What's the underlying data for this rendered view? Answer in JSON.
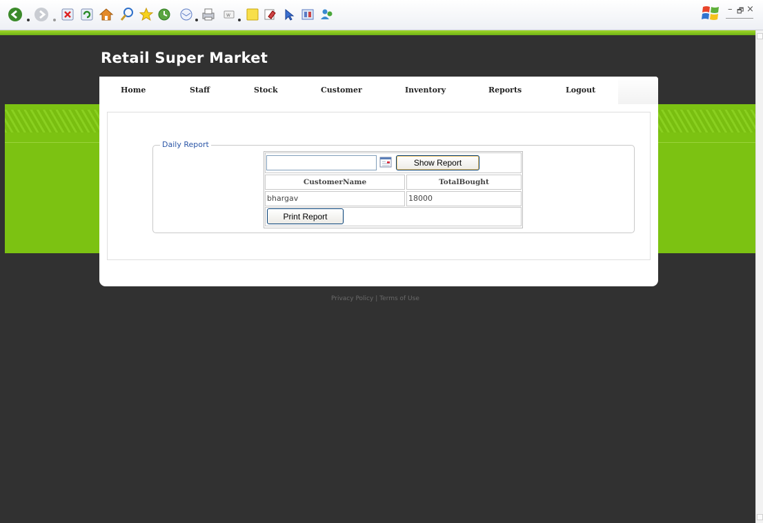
{
  "browser": {
    "toolbar_icons": [
      "back-icon",
      "forward-icon",
      "stop-icon",
      "refresh-icon",
      "home-icon",
      "search-icon",
      "favorites-icon",
      "history-icon",
      "mail-icon",
      "print-icon",
      "edit-icon",
      "notes-icon",
      "messenger-icon",
      "research-icon",
      "bookmark-icon",
      "users-icon"
    ],
    "window_controls": [
      "–",
      "🗗",
      "×"
    ]
  },
  "site": {
    "title": "Retail Super Market",
    "accent_color": "#7cc212",
    "background_color": "#313131"
  },
  "nav": {
    "items": [
      "Home",
      "Staff",
      "Stock",
      "Customer",
      "Inventory",
      "Reports",
      "Logout"
    ]
  },
  "report": {
    "legend": "Daily Report",
    "date_value": "",
    "show_button": "Show Report",
    "columns": [
      "CustomerName",
      "TotalBought"
    ],
    "rows": [
      {
        "customer_name": "bhargav",
        "total_bought": "18000"
      }
    ],
    "print_button": "Print Report"
  },
  "footer": {
    "privacy": "Privacy Policy",
    "separator": "|",
    "terms": "Terms of Use"
  }
}
